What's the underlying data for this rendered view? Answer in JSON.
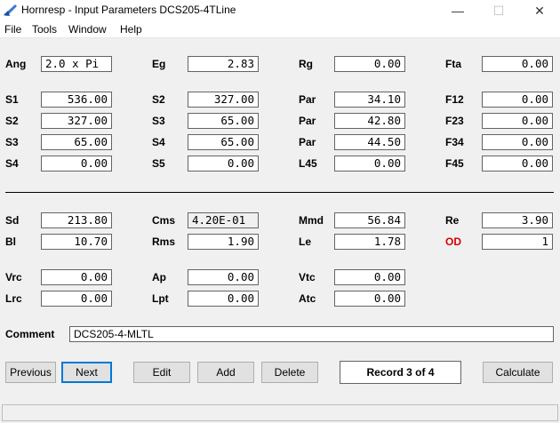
{
  "window": {
    "title": "Hornresp - Input Parameters   DCS205-4TLine",
    "minimize_glyph": "—",
    "maximize_glyph": "☐",
    "close_glyph": "✕"
  },
  "menu": {
    "file": "File",
    "tools": "Tools",
    "window": "Window",
    "help": "Help"
  },
  "params": {
    "ang": {
      "label": "Ang",
      "value": "2.0 x Pi"
    },
    "eg": {
      "label": "Eg",
      "value": "2.83"
    },
    "rg": {
      "label": "Rg",
      "value": "0.00"
    },
    "fta": {
      "label": "Fta",
      "value": "0.00"
    },
    "s1": {
      "label": "S1",
      "value": "536.00"
    },
    "s2a": {
      "label": "S2",
      "value": "327.00"
    },
    "par1": {
      "label": "Par",
      "value": "34.10"
    },
    "f12": {
      "label": "F12",
      "value": "0.00"
    },
    "s2b": {
      "label": "S2",
      "value": "327.00"
    },
    "s3a": {
      "label": "S3",
      "value": "65.00"
    },
    "par2": {
      "label": "Par",
      "value": "42.80"
    },
    "f23": {
      "label": "F23",
      "value": "0.00"
    },
    "s3b": {
      "label": "S3",
      "value": "65.00"
    },
    "s4a": {
      "label": "S4",
      "value": "65.00"
    },
    "par3": {
      "label": "Par",
      "value": "44.50"
    },
    "f34": {
      "label": "F34",
      "value": "0.00"
    },
    "s4b": {
      "label": "S4",
      "value": "0.00"
    },
    "s5": {
      "label": "S5",
      "value": "0.00"
    },
    "l45": {
      "label": "L45",
      "value": "0.00"
    },
    "f45": {
      "label": "F45",
      "value": "0.00"
    },
    "sd": {
      "label": "Sd",
      "value": "213.80"
    },
    "cms": {
      "label": "Cms",
      "value": "4.20E-01"
    },
    "mmd": {
      "label": "Mmd",
      "value": "56.84"
    },
    "re": {
      "label": "Re",
      "value": "3.90"
    },
    "bl": {
      "label": "Bl",
      "value": "10.70"
    },
    "rms": {
      "label": "Rms",
      "value": "1.90"
    },
    "le": {
      "label": "Le",
      "value": "1.78"
    },
    "od": {
      "label": "OD",
      "value": "1"
    },
    "vrc": {
      "label": "Vrc",
      "value": "0.00"
    },
    "ap": {
      "label": "Ap",
      "value": "0.00"
    },
    "vtc": {
      "label": "Vtc",
      "value": "0.00"
    },
    "lrc": {
      "label": "Lrc",
      "value": "0.00"
    },
    "lpt": {
      "label": "Lpt",
      "value": "0.00"
    },
    "atc": {
      "label": "Atc",
      "value": "0.00"
    }
  },
  "comment": {
    "label": "Comment",
    "value": "DCS205-4-MLTL"
  },
  "buttons": {
    "previous": "Previous",
    "next": "Next",
    "edit": "Edit",
    "add": "Add",
    "delete": "Delete",
    "record": "Record 3 of 4",
    "calculate": "Calculate"
  },
  "colors": {
    "accent": "#d40000",
    "focus": "#0078d7"
  }
}
